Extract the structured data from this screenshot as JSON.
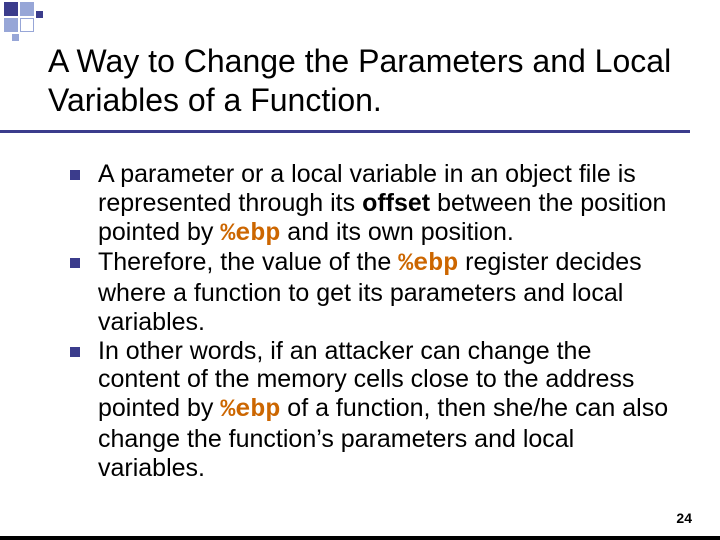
{
  "title": "A Way to Change the Parameters and Local Variables of a Function.",
  "bullets": [
    {
      "pre1": "A parameter or a local variable in an object file is represented through its ",
      "kw": "offset",
      "mid1": " between the position pointed by ",
      "code1": "%ebp",
      "post1": " and its own position."
    },
    {
      "pre": "Therefore, the value of the ",
      "code": "%ebp",
      "post": " register decides where a function to get its parameters and local variables."
    },
    {
      "pre": "In other words, if an attacker can change the content of the memory cells close to the address pointed by ",
      "code": "%ebp",
      "post": " of a function, then she/he can also change the function’s parameters and local variables."
    }
  ],
  "page_number": "24"
}
